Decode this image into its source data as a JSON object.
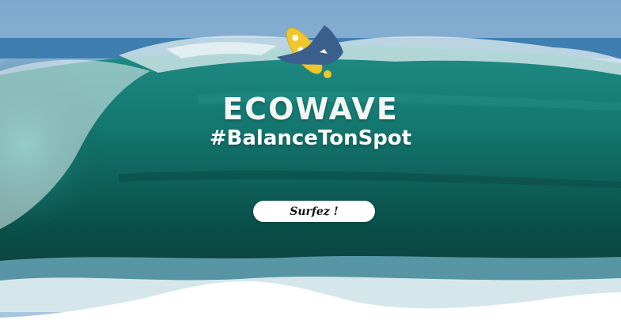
{
  "brand": {
    "name": "ECOWAVE",
    "tagline": "#BalanceTonSpot"
  },
  "cta": {
    "label": "Surfez !"
  },
  "colors": {
    "sky": "#8fb6d6",
    "wave_deep": "#0b4b45",
    "wave_mid": "#12706a",
    "foam": "#e7f1f3",
    "logo_blue": "#3a5f8c",
    "logo_yellow": "#f1c62c"
  },
  "icons": {
    "logo": "manta-ray-surfboard-logo"
  }
}
